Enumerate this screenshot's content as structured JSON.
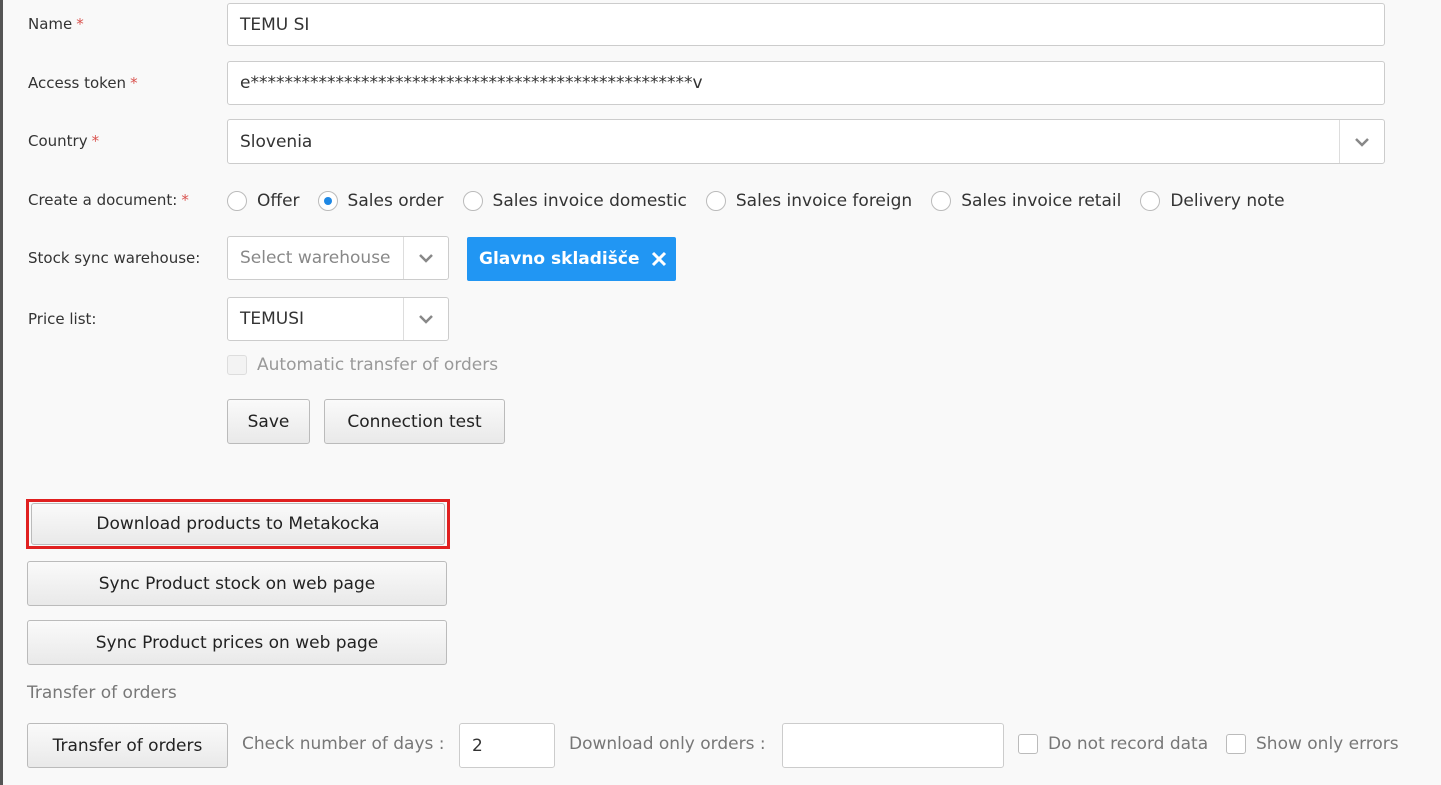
{
  "form": {
    "name_label": "Name",
    "name_value": "TEMU SI",
    "token_label": "Access token",
    "token_value": "e****************************************************v",
    "country_label": "Country",
    "country_value": "Slovenia",
    "document_label": "Create a document:",
    "document_options": [
      "Offer",
      "Sales order",
      "Sales invoice domestic",
      "Sales invoice foreign",
      "Sales invoice retail",
      "Delivery note"
    ],
    "document_selected": "Sales order",
    "required_mark": "*",
    "warehouse_label": "Stock sync warehouse:",
    "warehouse_placeholder": "Select warehouse",
    "warehouse_tag": "Glavno skladišče",
    "pricelist_label": "Price list:",
    "pricelist_value": "TEMUSI",
    "auto_transfer_label": "Automatic transfer of orders",
    "save_label": "Save",
    "connection_test_label": "Connection test"
  },
  "actions": {
    "download_products": "Download products to Metakocka",
    "sync_stock": "Sync Product stock on web page",
    "sync_prices": "Sync Product prices on web page"
  },
  "transfer": {
    "section_title": "Transfer of orders",
    "button_label": "Transfer of orders",
    "days_label": "Check number of days :",
    "days_value": "2",
    "download_only_label": "Download only orders :",
    "download_only_value": "",
    "do_not_record_label": "Do not record data",
    "show_only_errors_label": "Show only errors"
  },
  "colors": {
    "accent": "#2196f3",
    "required": "#d9534f",
    "highlight": "#e02020"
  }
}
